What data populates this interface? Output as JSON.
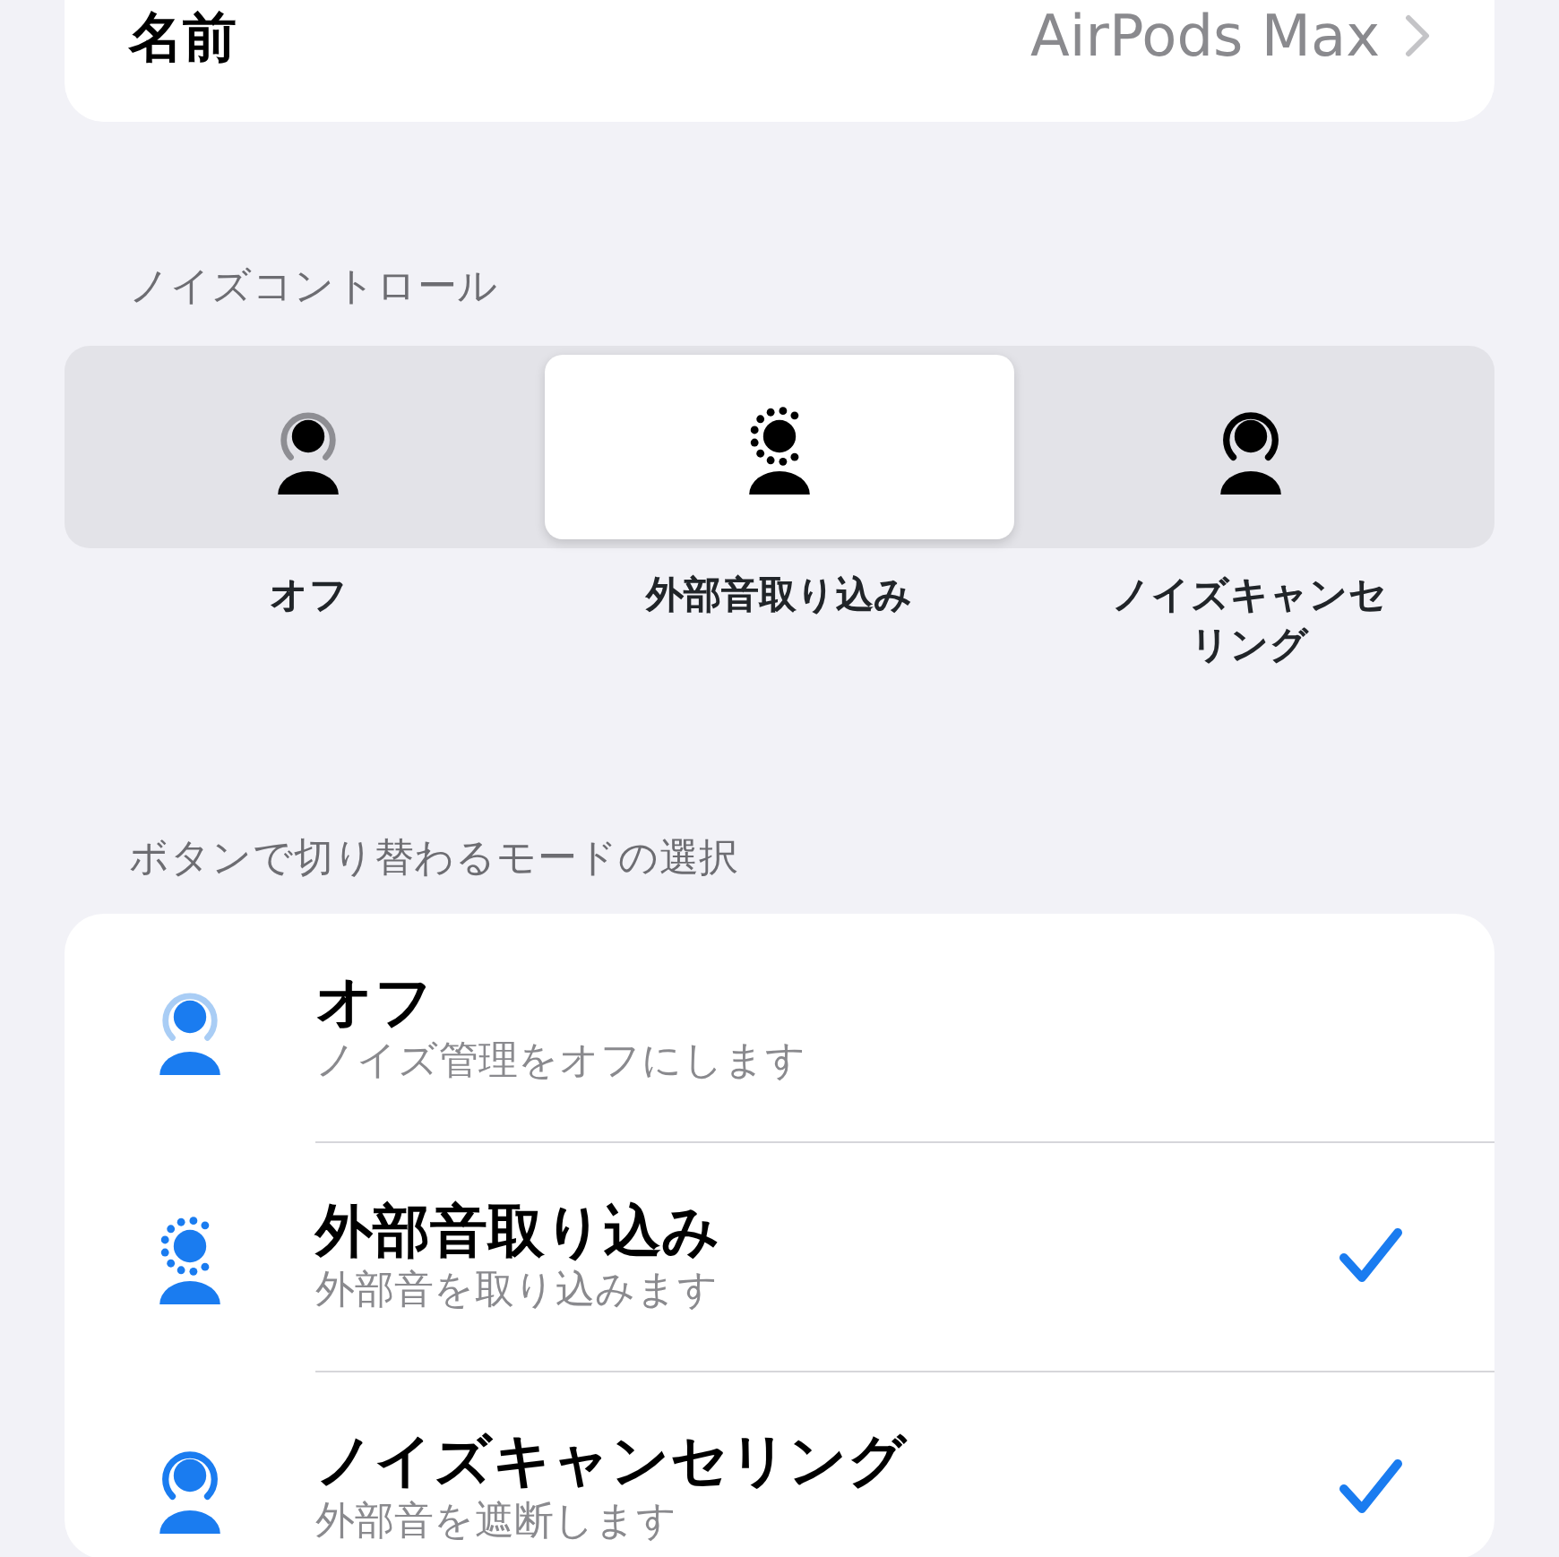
{
  "name_row": {
    "label": "名前",
    "value": "AirPods Max"
  },
  "noise_control": {
    "header": "ノイズコントロール",
    "segments": [
      {
        "kind": "off",
        "label": "オフ",
        "selected": false
      },
      {
        "kind": "transparency",
        "label": "外部音取り込み",
        "selected": true
      },
      {
        "kind": "anc",
        "label": "ノイズキャンセリング",
        "selected": false
      }
    ]
  },
  "button_modes": {
    "header": "ボタンで切り替わるモードの選択",
    "items": [
      {
        "kind": "off",
        "title": "オフ",
        "subtitle": "ノイズ管理をオフにします",
        "checked": false
      },
      {
        "kind": "transparency",
        "title": "外部音取り込み",
        "subtitle": "外部音を取り込みます",
        "checked": true
      },
      {
        "kind": "anc",
        "title": "ノイズキャンセリング",
        "subtitle": "外部音を遮断します",
        "checked": true
      }
    ]
  }
}
